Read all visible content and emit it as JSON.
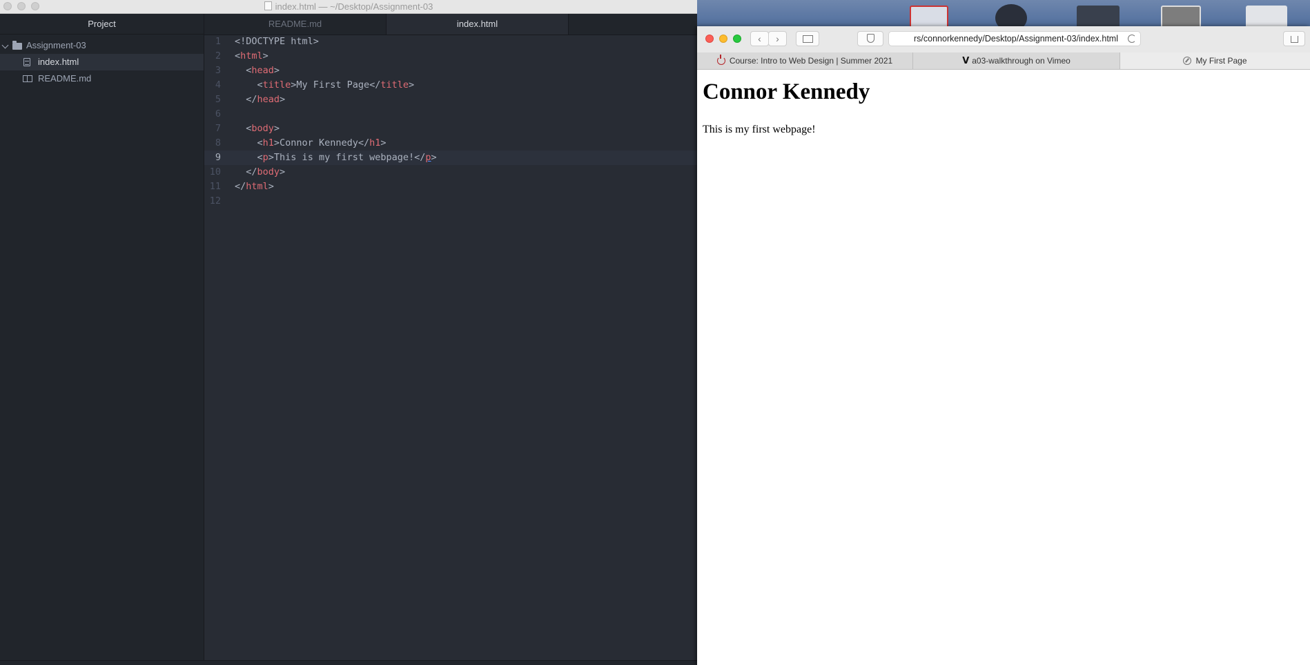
{
  "atom": {
    "window_title": "index.html — ~/Desktop/Assignment-03",
    "tree_header": "Project",
    "tree": [
      {
        "label": "Assignment-03",
        "type": "folder"
      },
      {
        "label": "index.html",
        "type": "file",
        "selected": true
      },
      {
        "label": "README.md",
        "type": "markdown"
      }
    ],
    "tabs": [
      {
        "label": "README.md",
        "active": false
      },
      {
        "label": "index.html",
        "active": true
      }
    ],
    "line_numbers": [
      "1",
      "2",
      "3",
      "4",
      "5",
      "6",
      "7",
      "8",
      "9",
      "10",
      "11",
      "12"
    ],
    "code": {
      "l1": "<!DOCTYPE html>",
      "l2_tag": "html",
      "l3_tag": "head",
      "l4_tag": "title",
      "l4_text": "My First Page",
      "l5_tag": "head",
      "l7_tag": "body",
      "l8_tag": "h1",
      "l8_text": "Connor Kennedy",
      "l9_tag": "p",
      "l9_text": "This is my first webpage!",
      "l10_tag": "body",
      "l11_tag": "html"
    },
    "cursor_line": 9
  },
  "safari": {
    "url": "rs/connorkennedy/Desktop/Assignment-03/index.html",
    "tabs": [
      {
        "label": "Course: Intro to Web Design | Summer 2021",
        "icon": "power-icon",
        "active": false
      },
      {
        "label": "a03-walkthrough on Vimeo",
        "icon": "vimeo-icon",
        "active": false
      },
      {
        "label": "My First Page",
        "icon": "compass-icon",
        "active": true
      }
    ],
    "page": {
      "heading": "Connor Kennedy",
      "paragraph": "This is my first webpage!"
    }
  },
  "colors": {
    "tag": "#e06c75",
    "text": "#abb2bf",
    "editor_bg": "#282c34",
    "sidebar_bg": "#21252b"
  }
}
